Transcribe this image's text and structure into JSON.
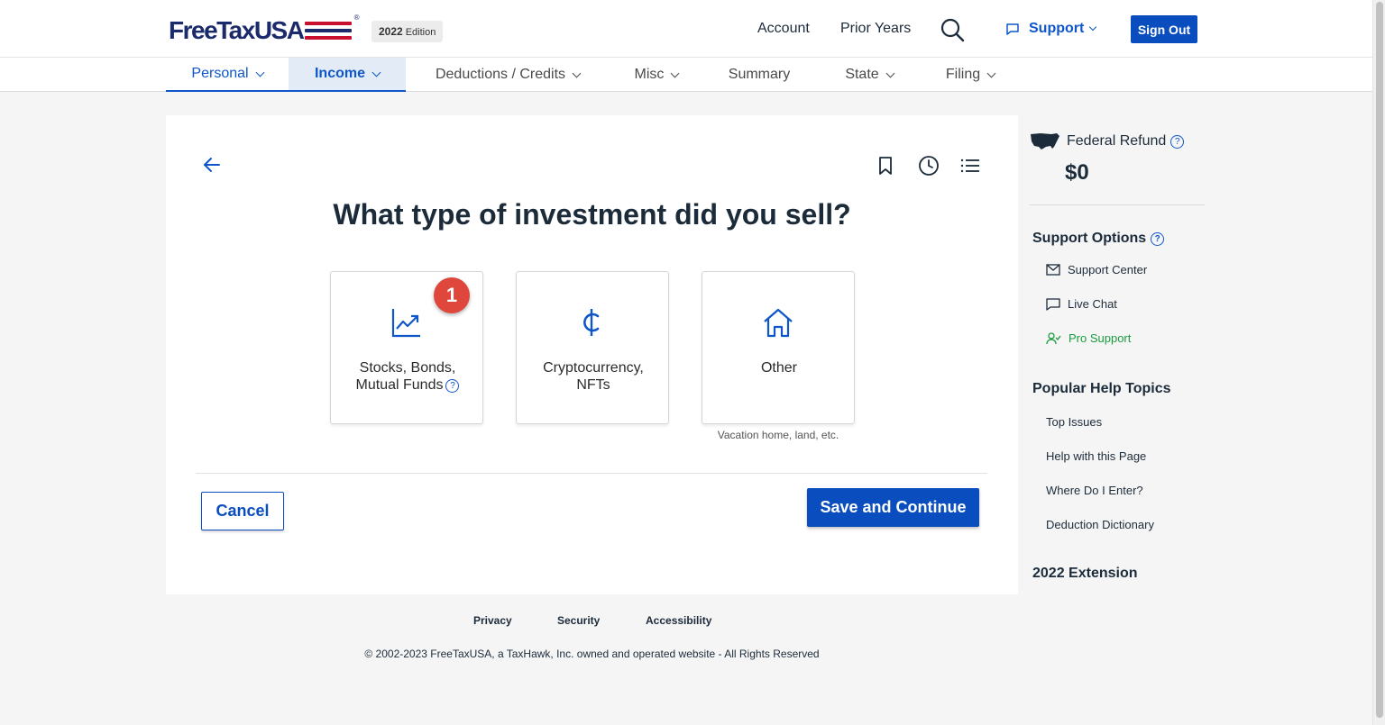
{
  "header": {
    "logo_text": "FreeTaxUSA",
    "edition_year": "2022",
    "edition_label": "Edition",
    "account": "Account",
    "prior_years": "Prior Years",
    "support": "Support",
    "sign_out": "Sign Out"
  },
  "nav": {
    "items": [
      {
        "label": "Personal"
      },
      {
        "label": "Income"
      },
      {
        "label": "Deductions / Credits"
      },
      {
        "label": "Misc"
      },
      {
        "label": "Summary"
      },
      {
        "label": "State"
      },
      {
        "label": "Filing"
      }
    ]
  },
  "main": {
    "question": "What type of investment did you sell?",
    "options": [
      {
        "line1": "Stocks, Bonds,",
        "line2": "Mutual Funds",
        "icon": "chart-trend-icon"
      },
      {
        "line1": "Cryptocurrency,",
        "line2": "NFTs",
        "icon": "cent-icon"
      },
      {
        "line1": "Other",
        "line2": "",
        "icon": "house-icon",
        "sublabel": "Vacation home, land, etc."
      }
    ],
    "badge": "1",
    "cancel": "Cancel",
    "save": "Save and Continue"
  },
  "sidebar": {
    "refund_label": "Federal Refund",
    "refund_amount": "$0",
    "support_heading": "Support Options",
    "support_links": [
      "Support Center",
      "Live Chat",
      "Pro Support"
    ],
    "help_heading": "Popular Help Topics",
    "help_links": [
      "Top Issues",
      "Help with this Page",
      "Where Do I Enter?",
      "Deduction Dictionary"
    ],
    "extension": "2022 Extension"
  },
  "footer": {
    "links": [
      "Privacy",
      "Security",
      "Accessibility"
    ],
    "copyright": "© 2002-2023 FreeTaxUSA, a TaxHawk, Inc. owned and operated website - All Rights Reserved"
  },
  "colors": {
    "brand_blue": "#0a4dbf",
    "link_blue": "#0e56c9",
    "badge_red": "#e0473c",
    "pro_green": "#1a9c3e"
  }
}
